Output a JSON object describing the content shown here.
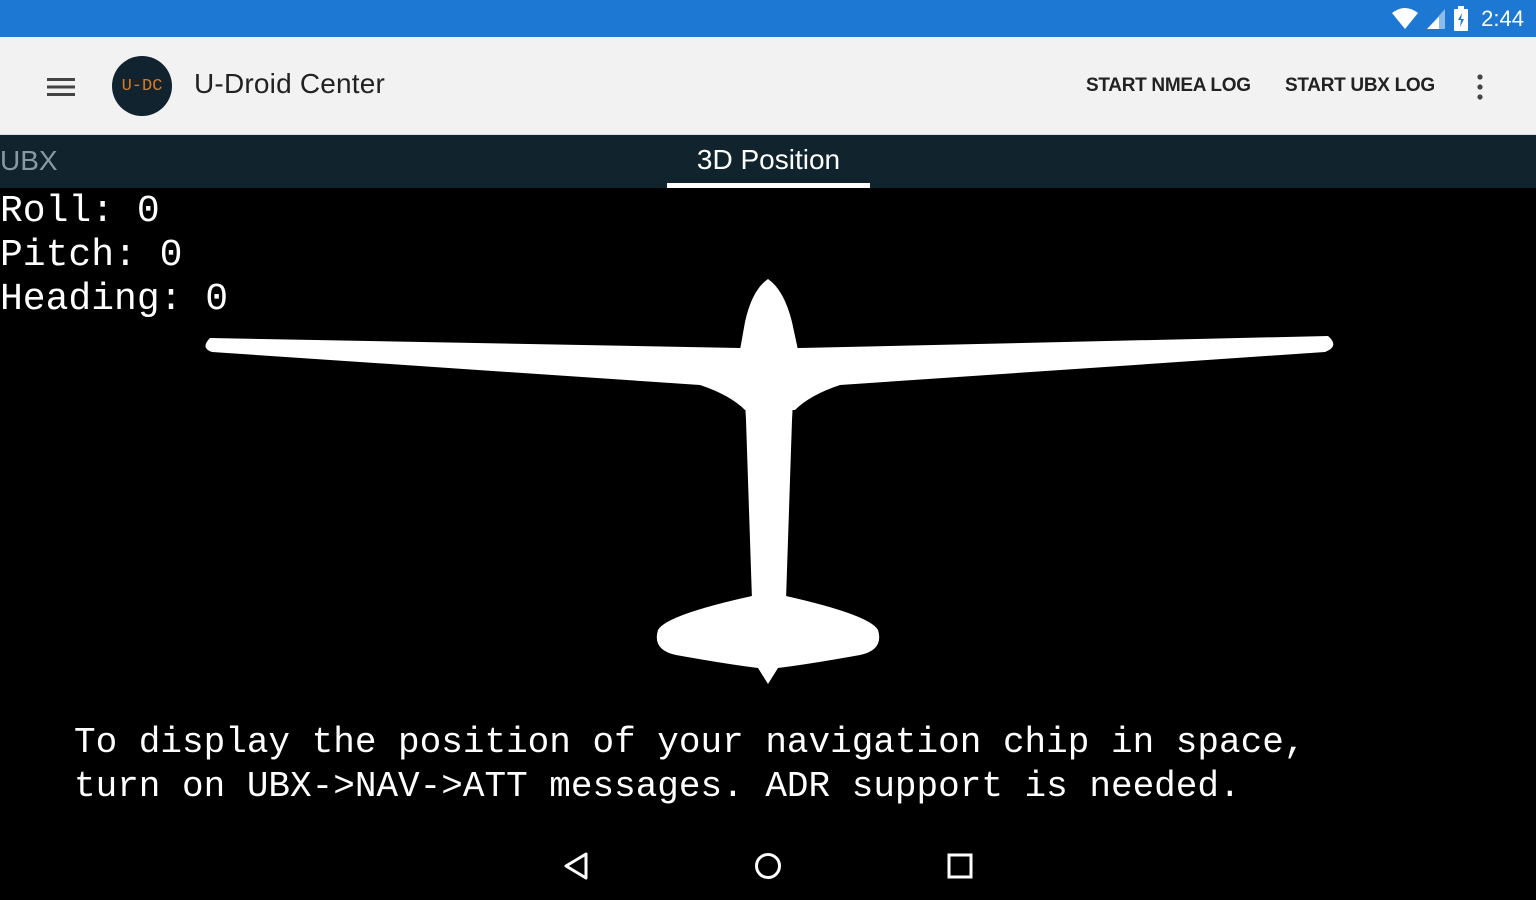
{
  "status_bar": {
    "time": "2:44",
    "battery_level": 0.9
  },
  "app_bar": {
    "title": "U-Droid Center",
    "logo_text": "U-DC",
    "actions": {
      "start_nmea": "START NMEA LOG",
      "start_ubx": "START UBX LOG"
    }
  },
  "tabs": {
    "ubx": "UBX",
    "position_3d": "3D Position"
  },
  "readout": {
    "roll": "Roll: 0",
    "pitch": "Pitch: 0",
    "heading": "Heading: 0"
  },
  "message": {
    "line1": "To display the position of your navigation chip in space,",
    "line2": "turn on UBX->NAV->ATT messages. ADR support is needed."
  },
  "colors": {
    "status_bar": "#1c78d3",
    "tab_bar": "#11242e",
    "logo_text": "#e07a1f"
  },
  "icons": {
    "menu": "hamburger-menu-icon",
    "overflow": "more-vert-icon",
    "back": "back-triangle-icon",
    "home": "home-circle-icon",
    "recents": "recents-square-icon"
  }
}
